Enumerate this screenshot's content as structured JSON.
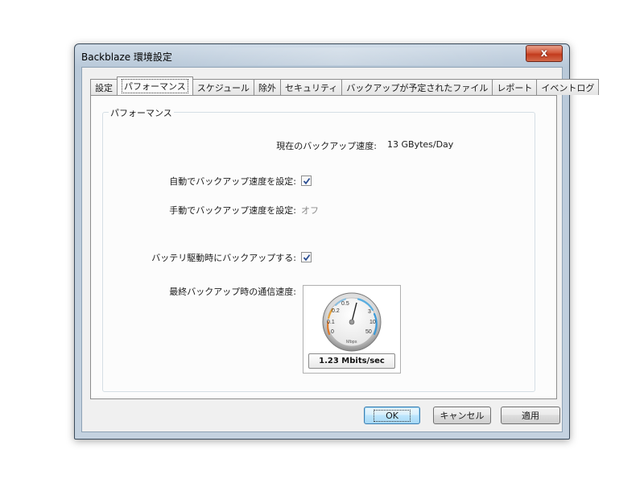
{
  "window": {
    "title": "Backblaze 環境設定",
    "close_glyph": "x"
  },
  "tabs": [
    {
      "label": "設定"
    },
    {
      "label": "パフォーマンス"
    },
    {
      "label": "スケジュール"
    },
    {
      "label": "除外"
    },
    {
      "label": "セキュリティ"
    },
    {
      "label": "バックアップが予定されたファイル"
    },
    {
      "label": "レポート"
    },
    {
      "label": "イベントログ"
    }
  ],
  "active_tab": "パフォーマンス",
  "group": {
    "title": "パフォーマンス",
    "current_speed_label": "現在のバックアップ速度:",
    "current_speed_value": "13 GBytes/Day",
    "auto_speed_label": "自動でバックアップ速度を設定:",
    "auto_speed_checked": true,
    "manual_speed_label": "手動でバックアップ速度を設定:",
    "manual_speed_value": "オフ",
    "battery_label": "バッテリ駆動時にバックアップする:",
    "battery_checked": true,
    "last_speed_label": "最終バックアップ時の通信速度:"
  },
  "gauge": {
    "ticks": [
      "0",
      "0.1",
      "0.2",
      "0.5",
      "3",
      "10",
      "50"
    ],
    "unit": "Mbps",
    "readout": "1.23 Mbits/sec",
    "value": 1.23
  },
  "buttons": {
    "ok": "OK",
    "cancel": "キャンセル",
    "apply": "適用"
  },
  "colors": {
    "check": "#2c4f93",
    "gauge_low": "#e07a2a",
    "gauge_high": "#3a9ad9"
  }
}
